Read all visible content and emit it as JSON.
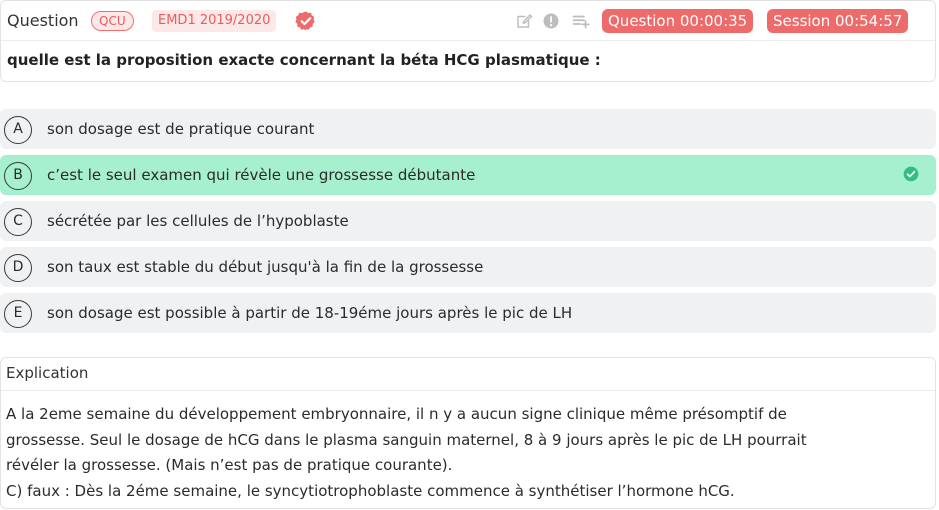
{
  "header": {
    "question_label": "Question",
    "type_badge": "QCU",
    "exam_tag": "EMD1 2019/2020",
    "question_timer": "Question 00:00:35",
    "session_timer": "Session 00:54:57"
  },
  "question": {
    "text": "quelle est la proposition exacte concernant la béta HCG plasmatique :"
  },
  "options": [
    {
      "letter": "A",
      "text": "son dosage est de pratique courant",
      "correct": false
    },
    {
      "letter": "B",
      "text": "c’est le seul examen qui révèle une grossesse débutante",
      "correct": true
    },
    {
      "letter": "C",
      "text": "sécrétée par les cellules de l’hypoblaste",
      "correct": false
    },
    {
      "letter": "D",
      "text": "son taux est stable du début jusqu'à la fin de la grossesse",
      "correct": false
    },
    {
      "letter": "E",
      "text": "son dosage est possible à partir de 18-19éme jours après le pic de LH",
      "correct": false
    }
  ],
  "explanation": {
    "title": "Explication",
    "lines": [
      "A la 2eme semaine du développement embryonnaire, il n y a aucun signe clinique même présomptif de",
      "grossesse. Seul le dosage de hCG dans le plasma sanguin maternel, 8 à 9 jours après le pic de LH pourrait",
      "révéler la grossesse. (Mais n’est pas de pratique courante).",
      "C) faux : Dès la 2éme semaine, le syncytiotrophoblaste commence à synthétiser l’hormone hCG."
    ]
  },
  "icons": {
    "verified": "verified-badge-icon",
    "edit": "edit-note-icon",
    "report": "alert-circle-icon",
    "add_to_list": "playlist-add-icon",
    "correct_check": "check-circle-icon"
  },
  "colors": {
    "accent_red": "#ee6b6b",
    "correct_green": "#a6efcf",
    "check_green": "#2fbf84",
    "option_bg": "#f0f1f3"
  }
}
